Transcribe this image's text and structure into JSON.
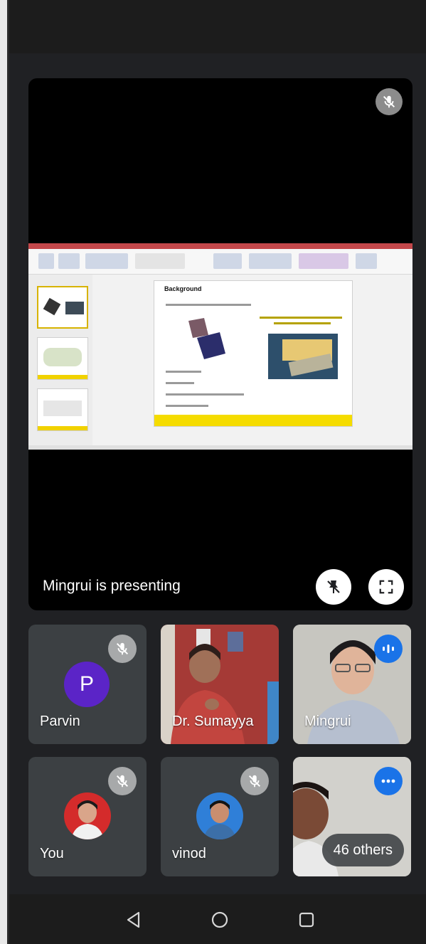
{
  "presentation": {
    "label": "Mingrui is presenting",
    "slide_title": "Background"
  },
  "participants": [
    {
      "name": "Parvin",
      "initial": "P",
      "mic": "muted"
    },
    {
      "name": "Dr. Sumayya",
      "mic": "unmuted"
    },
    {
      "name": "Mingrui",
      "mic": "speaking"
    },
    {
      "name": "You",
      "mic": "muted"
    },
    {
      "name": "vinod",
      "mic": "muted"
    }
  ],
  "others": {
    "label": "46 others",
    "speaking": true
  },
  "navbar": {
    "back": "back-icon",
    "home": "home-icon",
    "recents": "recents-icon"
  },
  "colors": {
    "background": "#202124",
    "tile": "#3c4043",
    "speaking_accent": "#1a73e8",
    "avatar_parvin": "#5b24c7",
    "slide_accent": "#f5dc00"
  }
}
